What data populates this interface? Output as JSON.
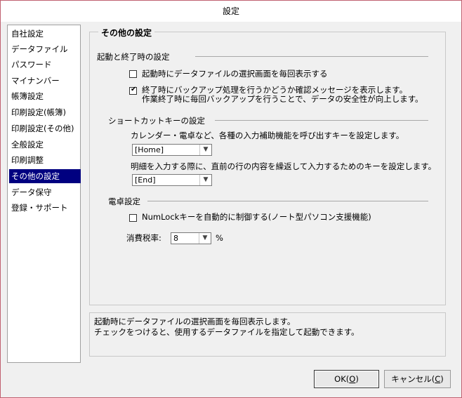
{
  "window": {
    "title": "設定"
  },
  "sidebar": {
    "items": [
      {
        "label": "自社設定",
        "selected": false
      },
      {
        "label": "データファイル",
        "selected": false
      },
      {
        "label": "パスワード",
        "selected": false
      },
      {
        "label": "マイナンバー",
        "selected": false
      },
      {
        "label": "帳簿設定",
        "selected": false
      },
      {
        "label": "印刷設定(帳簿)",
        "selected": false
      },
      {
        "label": "印刷設定(その他)",
        "selected": false
      },
      {
        "label": "全般設定",
        "selected": false
      },
      {
        "label": "印刷調整",
        "selected": false
      },
      {
        "label": "その他の設定",
        "selected": true
      },
      {
        "label": "データ保守",
        "selected": false
      },
      {
        "label": "登録・サポート",
        "selected": false
      }
    ]
  },
  "panel": {
    "title": "その他の設定",
    "startup": {
      "heading": "起動と終了時の設定",
      "show_selector": {
        "label": "起動時にデータファイルの選択画面を毎回表示する",
        "checked": false
      },
      "backup_confirm": {
        "label": "終了時にバックアップ処理を行うかどうか確認メッセージを表示します。",
        "label2": "作業終了時に毎回バックアップを行うことで、データの安全性が向上します。",
        "checked": true
      }
    },
    "shortcut": {
      "heading": "ショートカットキーの設定",
      "desc1": "カレンダー・電卓など、各種の入力補助機能を呼び出すキーを設定します。",
      "key1": "[Home]",
      "desc2": "明細を入力する際に、直前の行の内容を繰返して入力するためのキーを設定します。",
      "key2": "[End]"
    },
    "calculator": {
      "heading": "電卓設定",
      "numlock": {
        "label": "NumLockキーを自動的に制御する(ノート型パソコン支援機能)",
        "checked": false
      },
      "tax_label": "消費税率:",
      "tax_value": "8",
      "tax_unit": "%"
    }
  },
  "help": {
    "line1": "起動時にデータファイルの選択画面を毎回表示します。",
    "line2": "チェックをつけると、使用するデータファイルを指定して起動できます。"
  },
  "buttons": {
    "ok": {
      "label": "OK(",
      "key": "O",
      "end": ")"
    },
    "cancel": {
      "label": "キャンセル(",
      "key": "C",
      "end": ")"
    }
  },
  "icons": {
    "checkmark": "check-icon",
    "dropdown": "chevron-down-icon"
  }
}
